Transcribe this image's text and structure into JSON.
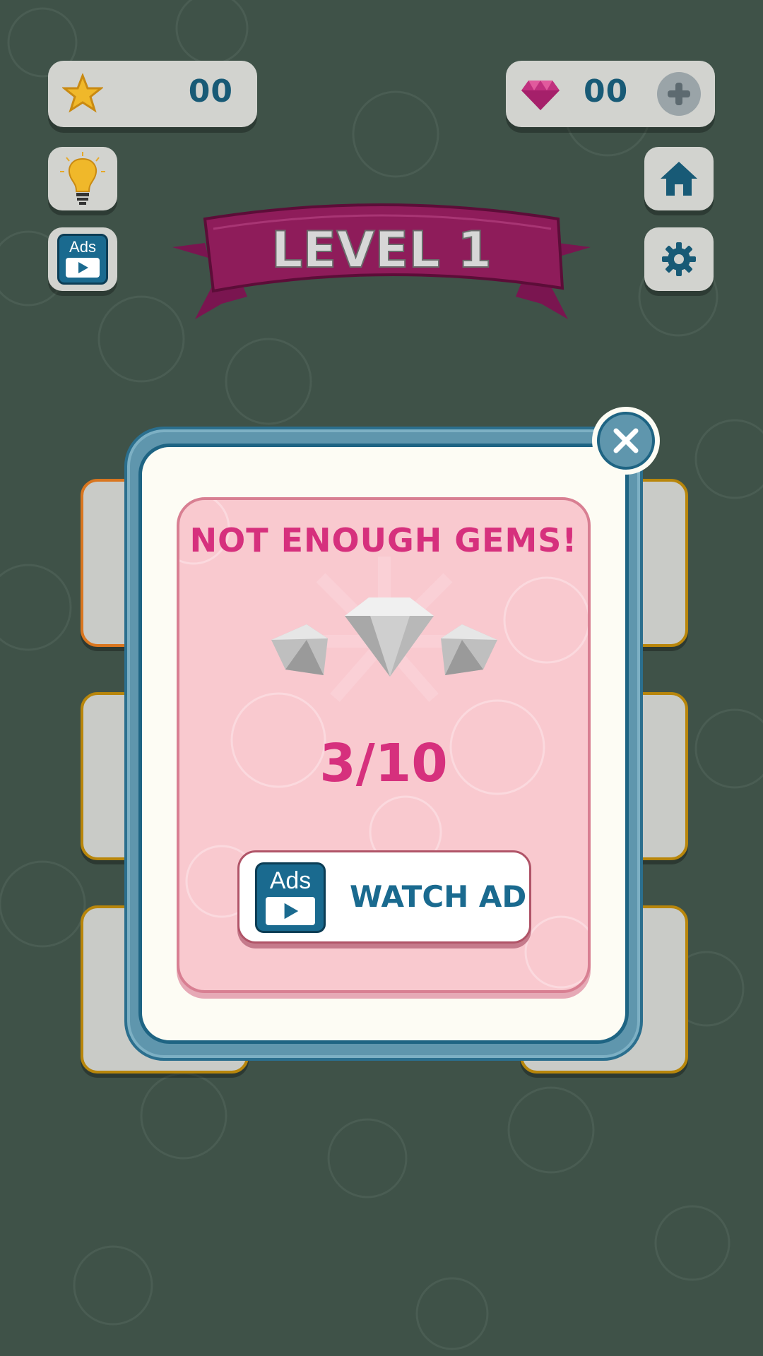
{
  "hud": {
    "stars": "00",
    "gems": "00"
  },
  "level": {
    "title": "LEVEL 1"
  },
  "popup": {
    "title": "NOT ENOUGH GEMS!",
    "progress": "3/10",
    "watch_ad_label": "WATCH AD",
    "ads_label": "Ads"
  },
  "side_buttons": {
    "ads_label": "Ads"
  },
  "colors": {
    "background": "#3f5248",
    "accent_pink": "#d6307d",
    "ribbon": "#8e1c5a",
    "modal_blue": "#5f96ad",
    "text_blue": "#1a6a8f"
  },
  "icons": [
    "star-icon",
    "gem-icon",
    "plus-icon",
    "lightbulb-icon",
    "ads-play-icon",
    "home-icon",
    "gear-icon",
    "close-icon",
    "diamond-icon"
  ]
}
